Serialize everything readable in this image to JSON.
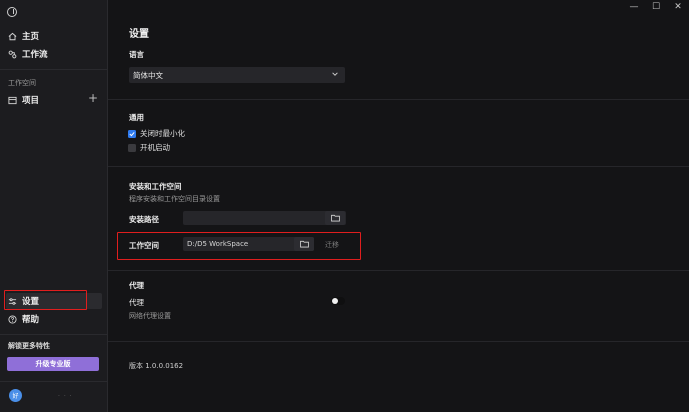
{
  "sidebar": {
    "nav": [
      {
        "label": "主页",
        "icon": "home-icon"
      },
      {
        "label": "工作流",
        "icon": "workflow-icon"
      }
    ],
    "workspace_section_label": "工作空间",
    "project": {
      "label": "项目",
      "icon": "project-icon"
    },
    "settings": {
      "label": "设置",
      "icon": "sliders-icon"
    },
    "help": {
      "label": "帮助",
      "icon": "help-icon"
    },
    "unlock_label": "解锁更多特性",
    "upgrade_label": "升级专业版",
    "avatar_initial": "好",
    "user_name": "· · ·"
  },
  "window_controls": {
    "minimize": "—",
    "maximize": "☐",
    "close": "✕"
  },
  "main": {
    "title": "设置",
    "language": {
      "title": "语言",
      "selected": "简体中文"
    },
    "general": {
      "title": "通用",
      "options": [
        {
          "label": "关闭时最小化",
          "checked": true
        },
        {
          "label": "开机启动",
          "checked": false
        }
      ]
    },
    "install": {
      "title": "安装和工作空间",
      "description": "程序安装和工作空间目录设置",
      "install_path_label": "安装路径",
      "install_path_value": "",
      "workspace_label": "工作空间",
      "workspace_value": "D:/D5 WorkSpace",
      "migrate_label": "迁移"
    },
    "proxy": {
      "title": "代理",
      "label": "代理",
      "description": "网络代理设置",
      "enabled": false
    },
    "version": "版本 1.0.0.0162"
  },
  "colors": {
    "accent_purple": "#8f6fd8",
    "checkbox_blue": "#2f7bf0",
    "highlight_red": "#e01e1e",
    "avatar_blue": "#4a8fe8"
  }
}
